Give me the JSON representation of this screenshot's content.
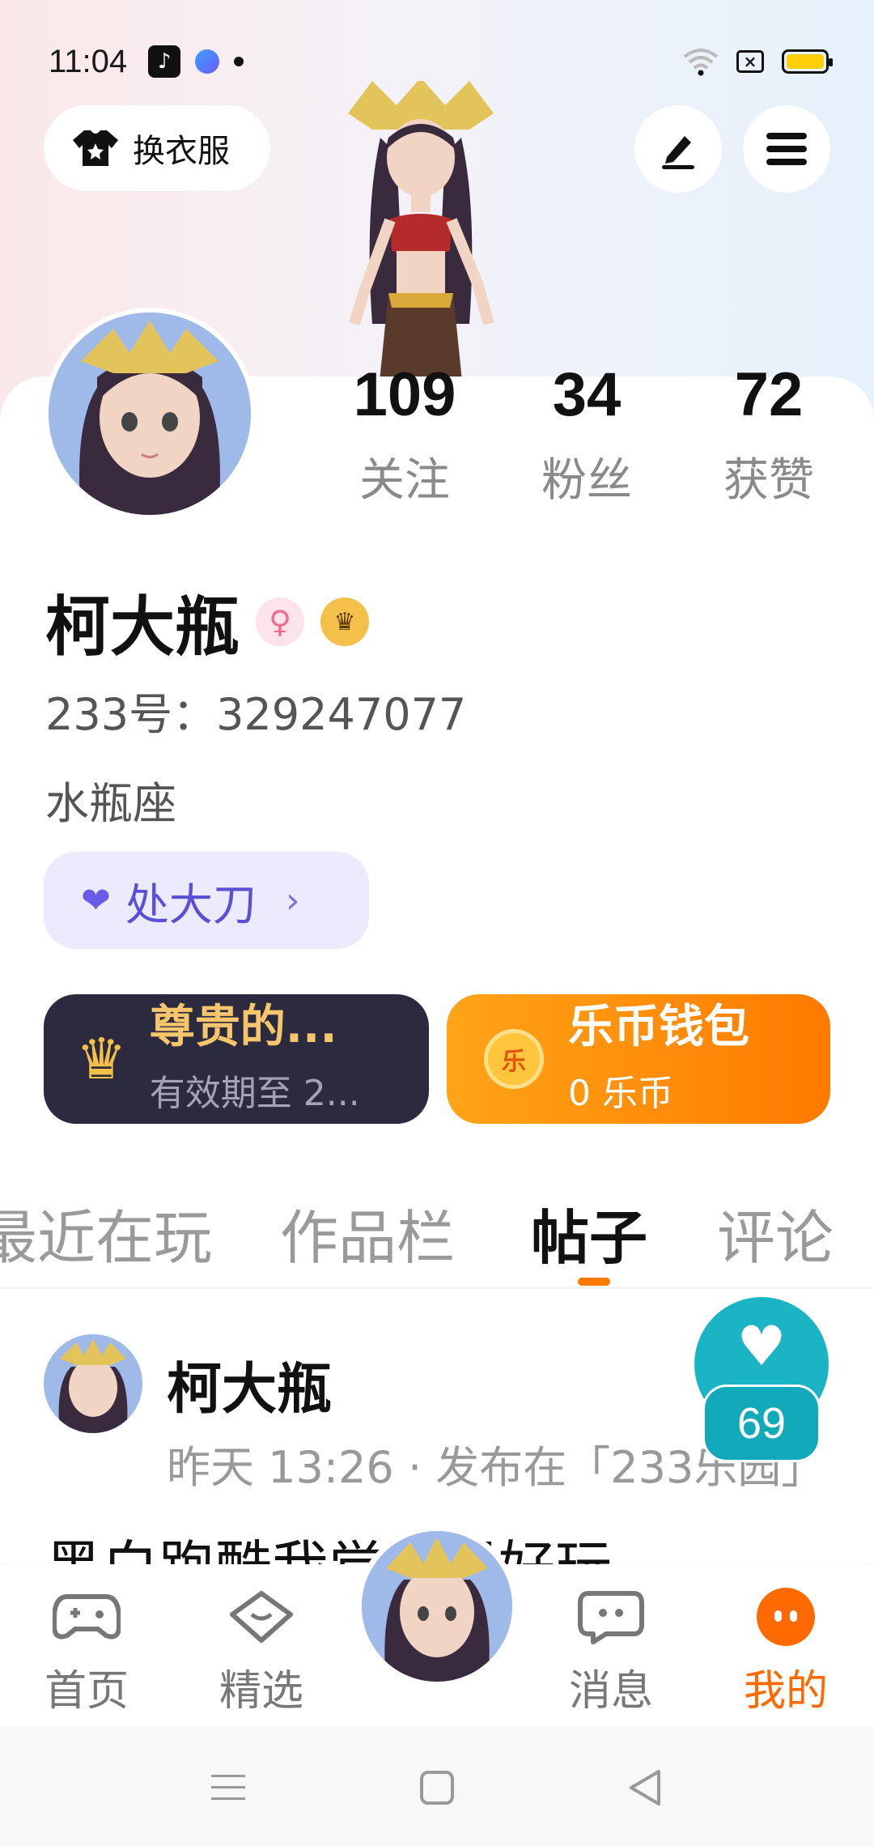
{
  "status_bar": {
    "time": "11:04"
  },
  "header": {
    "dress_button_label": "换衣服"
  },
  "stats": [
    {
      "value": "109",
      "label": "关注"
    },
    {
      "value": "34",
      "label": "粉丝"
    },
    {
      "value": "72",
      "label": "获赞"
    }
  ],
  "profile": {
    "name": "柯大瓶",
    "uid_text": "233号：329247077",
    "zodiac": "水瓶座",
    "tag_label": "处大刀",
    "gender_symbol": "♀"
  },
  "vip_card": {
    "title": "尊贵的...",
    "subtitle": "有效期至 2..."
  },
  "coin_card": {
    "icon_text": "乐",
    "title": "乐币钱包",
    "subtitle": "0 乐币"
  },
  "tabs": [
    {
      "label": "最近在玩",
      "active": false
    },
    {
      "label": "作品栏",
      "active": false
    },
    {
      "label": "帖子",
      "active": true
    },
    {
      "label": "评论",
      "active": false
    }
  ],
  "post": {
    "author": "柯大瓶",
    "meta": "昨天 13:26 · 发布在「233乐园」",
    "text": "黑白跑酷我觉得很好玩",
    "like_count": "69"
  },
  "bottom_nav": [
    {
      "label": "首页",
      "icon": "gamepad-icon"
    },
    {
      "label": "精选",
      "icon": "heart-badge-icon"
    },
    {
      "label": "消息",
      "icon": "chat-icon"
    },
    {
      "label": "我的",
      "icon": "smile-icon"
    }
  ],
  "colors": {
    "accent": "#ff7a00",
    "like_fab": "#1bb4c4",
    "tag_text": "#5b4fd6",
    "vip_bg": "#2b2a3f"
  }
}
